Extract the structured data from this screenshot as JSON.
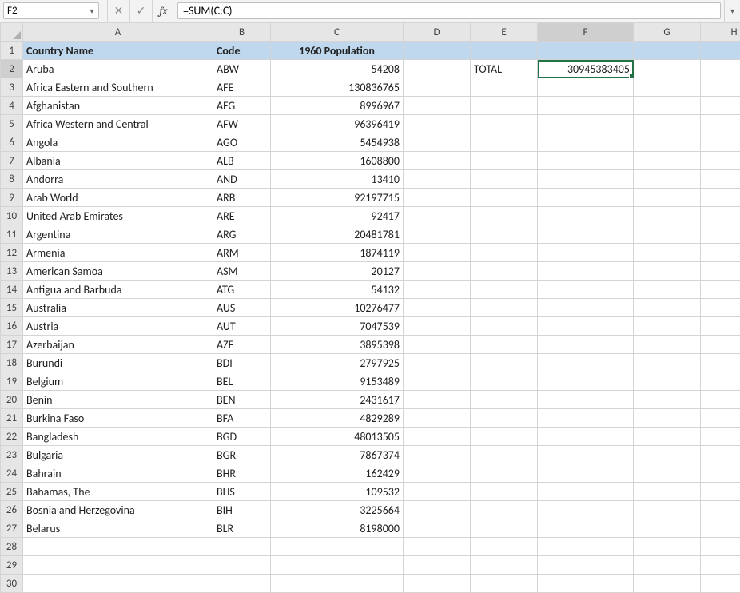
{
  "formula_bar": {
    "name_box": "F2",
    "cancel": "✕",
    "confirm": "✓",
    "fx": "fx",
    "formula": "=SUM(C:C)"
  },
  "columns": [
    "A",
    "B",
    "C",
    "D",
    "E",
    "F",
    "G",
    "H"
  ],
  "active_cell": {
    "col": "F",
    "row": 2
  },
  "header_row": {
    "A": "Country Name",
    "B": "Code",
    "C": "1960 Population"
  },
  "total": {
    "label": "TOTAL",
    "value": "30945383405"
  },
  "rows": [
    {
      "n": 2,
      "A": "Aruba",
      "B": "ABW",
      "C": "54208"
    },
    {
      "n": 3,
      "A": "Africa Eastern and Southern",
      "B": "AFE",
      "C": "130836765"
    },
    {
      "n": 4,
      "A": "Afghanistan",
      "B": "AFG",
      "C": "8996967"
    },
    {
      "n": 5,
      "A": "Africa Western and Central",
      "B": "AFW",
      "C": "96396419"
    },
    {
      "n": 6,
      "A": "Angola",
      "B": "AGO",
      "C": "5454938"
    },
    {
      "n": 7,
      "A": "Albania",
      "B": "ALB",
      "C": "1608800"
    },
    {
      "n": 8,
      "A": "Andorra",
      "B": "AND",
      "C": "13410"
    },
    {
      "n": 9,
      "A": "Arab World",
      "B": "ARB",
      "C": "92197715"
    },
    {
      "n": 10,
      "A": "United Arab Emirates",
      "B": "ARE",
      "C": "92417"
    },
    {
      "n": 11,
      "A": "Argentina",
      "B": "ARG",
      "C": "20481781"
    },
    {
      "n": 12,
      "A": "Armenia",
      "B": "ARM",
      "C": "1874119"
    },
    {
      "n": 13,
      "A": "American Samoa",
      "B": "ASM",
      "C": "20127"
    },
    {
      "n": 14,
      "A": "Antigua and Barbuda",
      "B": "ATG",
      "C": "54132"
    },
    {
      "n": 15,
      "A": "Australia",
      "B": "AUS",
      "C": "10276477"
    },
    {
      "n": 16,
      "A": "Austria",
      "B": "AUT",
      "C": "7047539"
    },
    {
      "n": 17,
      "A": "Azerbaijan",
      "B": "AZE",
      "C": "3895398"
    },
    {
      "n": 18,
      "A": "Burundi",
      "B": "BDI",
      "C": "2797925"
    },
    {
      "n": 19,
      "A": "Belgium",
      "B": "BEL",
      "C": "9153489"
    },
    {
      "n": 20,
      "A": "Benin",
      "B": "BEN",
      "C": "2431617"
    },
    {
      "n": 21,
      "A": "Burkina Faso",
      "B": "BFA",
      "C": "4829289"
    },
    {
      "n": 22,
      "A": "Bangladesh",
      "B": "BGD",
      "C": "48013505"
    },
    {
      "n": 23,
      "A": "Bulgaria",
      "B": "BGR",
      "C": "7867374"
    },
    {
      "n": 24,
      "A": "Bahrain",
      "B": "BHR",
      "C": "162429"
    },
    {
      "n": 25,
      "A": "Bahamas, The",
      "B": "BHS",
      "C": "109532"
    },
    {
      "n": 26,
      "A": "Bosnia and Herzegovina",
      "B": "BIH",
      "C": "3225664"
    },
    {
      "n": 27,
      "A": "Belarus",
      "B": "BLR",
      "C": "8198000"
    }
  ]
}
